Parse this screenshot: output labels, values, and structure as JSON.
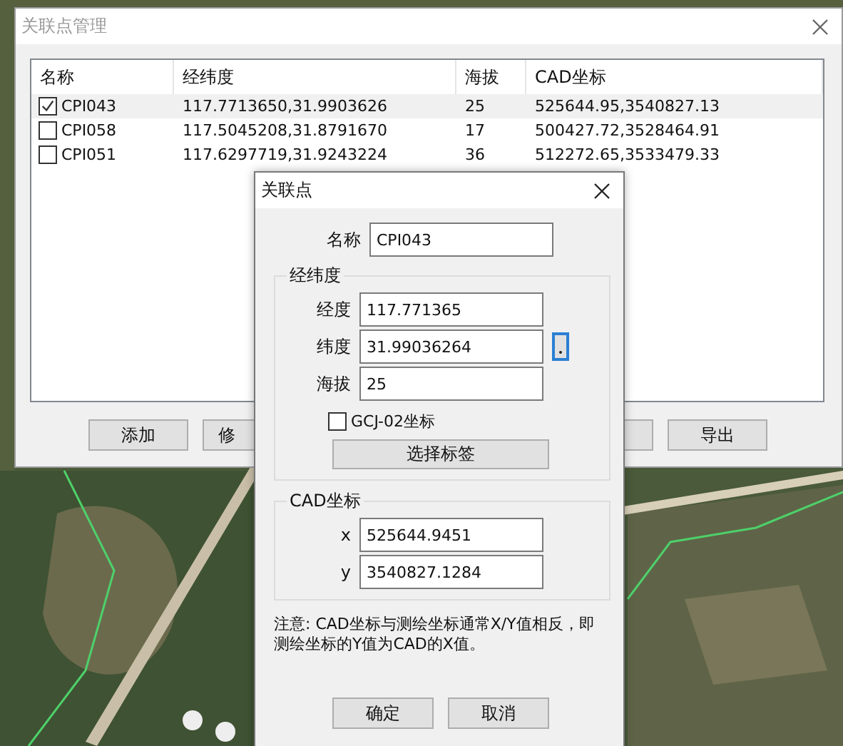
{
  "manager_window": {
    "title": "关联点管理",
    "table": {
      "columns": [
        "名称",
        "经纬度",
        "海拔",
        "CAD坐标"
      ],
      "rows": [
        {
          "checked": true,
          "selected": true,
          "cells": [
            "CPI043",
            "117.7713650,31.9903626",
            "25",
            "525644.95,3540827.13"
          ]
        },
        {
          "checked": false,
          "selected": false,
          "cells": [
            "CPI058",
            "117.5045208,31.8791670",
            "17",
            "500427.72,3528464.91"
          ]
        },
        {
          "checked": false,
          "selected": false,
          "cells": [
            "CPI051",
            "117.6297719,31.9243224",
            "36",
            "512272.65,3533479.33"
          ]
        }
      ]
    },
    "buttons": [
      "添加",
      "修"
    ],
    "export_button": "导出"
  },
  "point_dialog": {
    "title": "关联点",
    "name": {
      "label": "名称",
      "value": "CPI043"
    },
    "geo_group": {
      "title": "经纬度",
      "fields": [
        {
          "label": "经度",
          "value": "117.771365"
        },
        {
          "label": "纬度",
          "value": "31.99036264"
        },
        {
          "label": "海拔",
          "value": "25"
        }
      ],
      "gcj02": {
        "label": "GCJ-02坐标",
        "checked": false
      },
      "select_tag_button": "选择标签"
    },
    "cad_group": {
      "title": "CAD坐标",
      "fields": [
        {
          "label": "x",
          "value": "525644.9451"
        },
        {
          "label": "y",
          "value": "3540827.1284"
        }
      ]
    },
    "note": "注意: CAD坐标与测绘坐标通常X/Y值相反，即测绘坐标的Y值为CAD的X值。",
    "buttons": [
      "确定",
      "取消"
    ]
  }
}
